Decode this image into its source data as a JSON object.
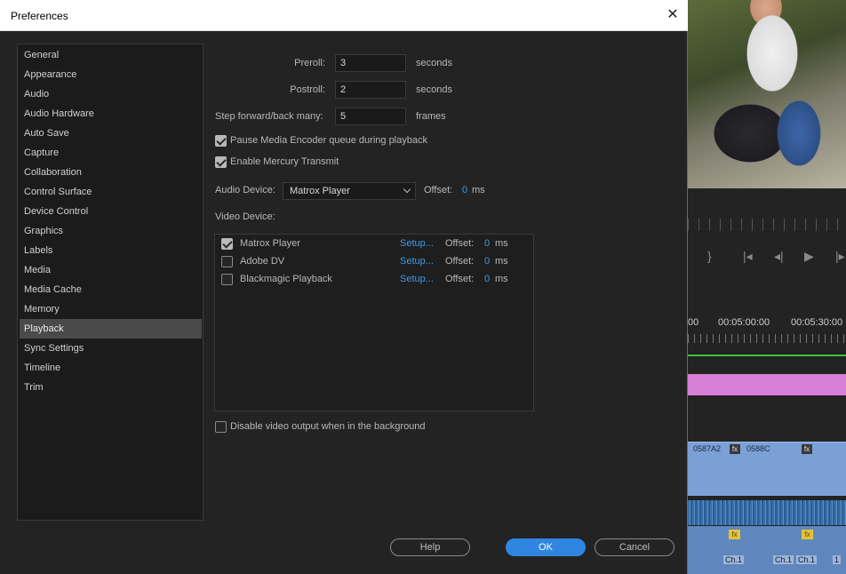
{
  "dialog": {
    "title": "Preferences",
    "close_glyph": "✕"
  },
  "sidebar": {
    "items": [
      {
        "label": "General"
      },
      {
        "label": "Appearance"
      },
      {
        "label": "Audio"
      },
      {
        "label": "Audio Hardware"
      },
      {
        "label": "Auto Save"
      },
      {
        "label": "Capture"
      },
      {
        "label": "Collaboration"
      },
      {
        "label": "Control Surface"
      },
      {
        "label": "Device Control"
      },
      {
        "label": "Graphics"
      },
      {
        "label": "Labels"
      },
      {
        "label": "Media"
      },
      {
        "label": "Media Cache"
      },
      {
        "label": "Memory"
      },
      {
        "label": "Playback",
        "selected": true
      },
      {
        "label": "Sync Settings"
      },
      {
        "label": "Timeline"
      },
      {
        "label": "Trim"
      }
    ]
  },
  "playback": {
    "preroll": {
      "label": "Preroll:",
      "value": "3",
      "unit": "seconds"
    },
    "postroll": {
      "label": "Postroll:",
      "value": "2",
      "unit": "seconds"
    },
    "step": {
      "label": "Step forward/back many:",
      "value": "5",
      "unit": "frames"
    },
    "pause_encoder": {
      "label": "Pause Media Encoder queue during playback",
      "checked": true
    },
    "mercury_transmit": {
      "label": "Enable Mercury Transmit",
      "checked": true
    },
    "audio_device": {
      "label": "Audio Device:",
      "value": "Matrox Player",
      "offset_label": "Offset:",
      "offset_value": "0",
      "offset_unit": "ms"
    },
    "video_device_label": "Video Device:",
    "video_devices": [
      {
        "name": "Matrox Player",
        "checked": true,
        "setup": "Setup...",
        "offset_label": "Offset:",
        "offset_value": "0",
        "offset_unit": "ms"
      },
      {
        "name": "Adobe DV",
        "checked": false,
        "setup": "Setup...",
        "offset_label": "Offset:",
        "offset_value": "0",
        "offset_unit": "ms"
      },
      {
        "name": "Blackmagic Playback",
        "checked": false,
        "setup": "Setup...",
        "offset_label": "Offset:",
        "offset_value": "0",
        "offset_unit": "ms"
      }
    ],
    "disable_bg_output": {
      "label": "Disable video output when in the background",
      "checked": false
    }
  },
  "buttons": {
    "help": "Help",
    "ok": "OK",
    "cancel": "Cancel"
  },
  "background_app": {
    "timecodes": [
      "00",
      "00:05:00:00",
      "00:05:30:00"
    ],
    "clip_labels": [
      "0587A2",
      "0588C"
    ],
    "fx_label": "fx",
    "channel_labels": [
      "Ch.1",
      "Ch.1",
      "Ch.1",
      "1"
    ]
  },
  "colors": {
    "accent": "#2f86e0",
    "link": "#3d9ae8",
    "selected_nav": "#4a4a4a"
  }
}
